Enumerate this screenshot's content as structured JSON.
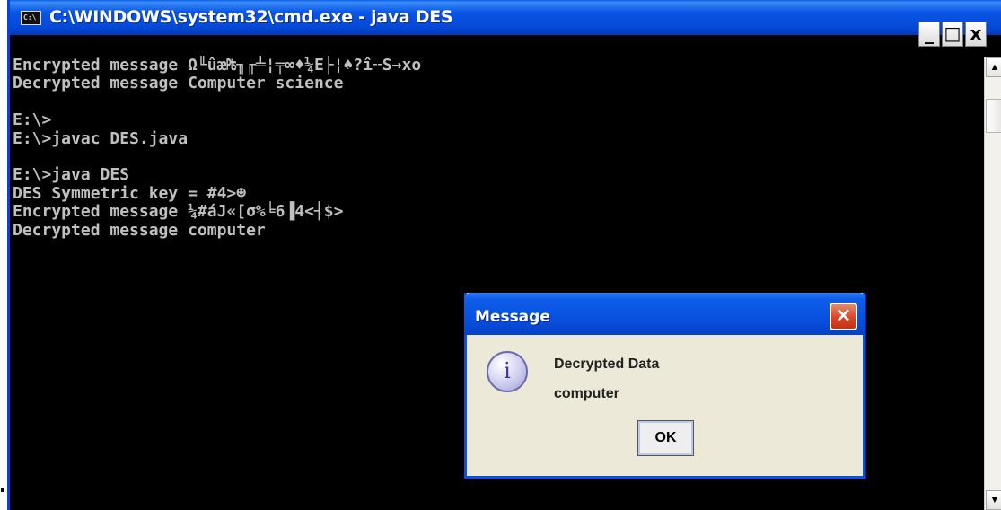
{
  "window": {
    "icon_text": "C:\\",
    "title": "C:\\WINDOWS\\system32\\cmd.exe - java DES",
    "min_label": "_",
    "max_label": "□",
    "close_label": "x"
  },
  "console": {
    "lines": [
      "Encrypted message Ω╙ûæ₧╖╓╧¦╤∞♦¼Ε├¦♠?î╌S→xo",
      "Decrypted message Computer science",
      "",
      "E:\\>",
      "E:\\>javac DES.java",
      "",
      "E:\\>java DES",
      "DES Symmetric key = #4>☻",
      "Encrypted message ¼#áJ«[σ%╘6▐4<┤$>",
      "Decrypted message computer"
    ]
  },
  "scrollbar": {
    "up_arrow": "▲",
    "down_arrow": "▼"
  },
  "dialog": {
    "title": "Message",
    "close_label": "×",
    "info_glyph": "i",
    "line1": "Decrypted Data",
    "line2": "computer",
    "ok_label": "OK"
  },
  "colors": {
    "console_bg": "#000000",
    "console_text": "#c0c0c0",
    "titlebar_blue": "#0548d6",
    "dialog_bg": "#ece9d8"
  }
}
